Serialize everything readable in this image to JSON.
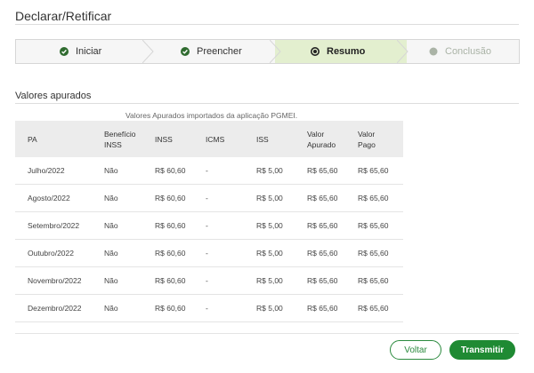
{
  "page": {
    "title": "Declarar/Retificar"
  },
  "stepper": {
    "steps": [
      {
        "label": "Iniciar",
        "state": "done"
      },
      {
        "label": "Preencher",
        "state": "done"
      },
      {
        "label": "Resumo",
        "state": "active"
      },
      {
        "label": "Conclusão",
        "state": "pending"
      }
    ]
  },
  "section": {
    "title": "Valores apurados",
    "caption": "Valores Apurados importados da aplicação PGMEI."
  },
  "table": {
    "headers": [
      "PA",
      "Benefício INSS",
      "INSS",
      "ICMS",
      "ISS",
      "Valor Apurado",
      "Valor Pago"
    ],
    "rows": [
      [
        "Julho/2022",
        "Não",
        "R$ 60,60",
        "-",
        "R$ 5,00",
        "R$ 65,60",
        "R$ 65,60"
      ],
      [
        "Agosto/2022",
        "Não",
        "R$ 60,60",
        "-",
        "R$ 5,00",
        "R$ 65,60",
        "R$ 65,60"
      ],
      [
        "Setembro/2022",
        "Não",
        "R$ 60,60",
        "-",
        "R$ 5,00",
        "R$ 65,60",
        "R$ 65,60"
      ],
      [
        "Outubro/2022",
        "Não",
        "R$ 60,60",
        "-",
        "R$ 5,00",
        "R$ 65,60",
        "R$ 65,60"
      ],
      [
        "Novembro/2022",
        "Não",
        "R$ 60,60",
        "-",
        "R$ 5,00",
        "R$ 65,60",
        "R$ 65,60"
      ],
      [
        "Dezembro/2022",
        "Não",
        "R$ 60,60",
        "-",
        "R$ 5,00",
        "R$ 65,60",
        "R$ 65,60"
      ]
    ]
  },
  "actions": {
    "back_label": "Voltar",
    "submit_label": "Transmitir"
  },
  "colors": {
    "accent": "#1f8a33",
    "active_step_bg": "#e3efcf"
  }
}
